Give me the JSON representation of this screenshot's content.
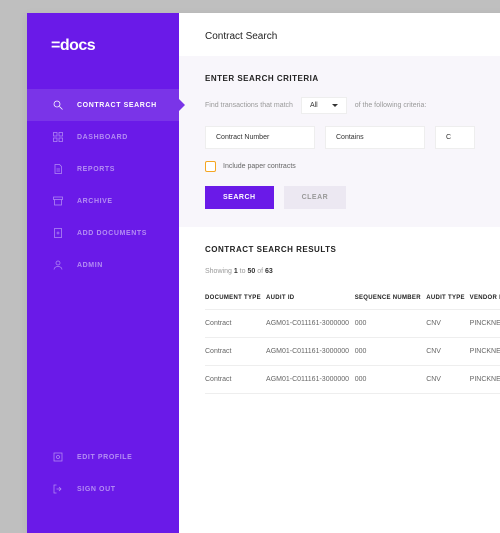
{
  "logo": "=docs",
  "page_title": "Contract Search",
  "sidebar": {
    "items": [
      {
        "label": "CONTRACT SEARCH",
        "active": true
      },
      {
        "label": "DASHBOARD"
      },
      {
        "label": "REPORTS"
      },
      {
        "label": "ARCHIVE"
      },
      {
        "label": "ADD DOCUMENTS"
      },
      {
        "label": "ADMIN"
      }
    ],
    "bottom": [
      {
        "label": "EDIT PROFILE"
      },
      {
        "label": "SIGN OUT"
      }
    ]
  },
  "criteria": {
    "title": "ENTER SEARCH CRITERIA",
    "match_prefix": "Find transactions that match",
    "match_value": "All",
    "match_suffix": "of the following criteria:",
    "field": "Contract Number",
    "operator": "Contains",
    "value": "C",
    "include_paper_label": "Include paper contracts",
    "search_label": "SEARCH",
    "clear_label": "CLEAR"
  },
  "results": {
    "title": "CONTRACT SEARCH RESULTS",
    "meta_showing": "Showing",
    "meta_from": "1",
    "meta_to_word": "to",
    "meta_to": "50",
    "meta_of_word": "of",
    "meta_total": "63",
    "columns": [
      "DOCUMENT TYPE",
      "AUDIT ID",
      "SEQUENCE NUMBER",
      "AUDIT TYPE",
      "VENDOR NAME"
    ],
    "rows": [
      {
        "doc_type": "Contract",
        "audit_id": "AGM01-C011161-3000000",
        "seq": "000",
        "audit_type": "CNV",
        "vendor": "PINCKNEY HUGO G"
      },
      {
        "doc_type": "Contract",
        "audit_id": "AGM01-C011161-3000000",
        "seq": "000",
        "audit_type": "CNV",
        "vendor": "PINCKNEY HUGO G"
      },
      {
        "doc_type": "Contract",
        "audit_id": "AGM01-C011161-3000000",
        "seq": "000",
        "audit_type": "CNV",
        "vendor": "PINCKNEY HUGO G"
      }
    ]
  },
  "colors": {
    "primary": "#6a1ae8",
    "accent": "#f5a623"
  }
}
